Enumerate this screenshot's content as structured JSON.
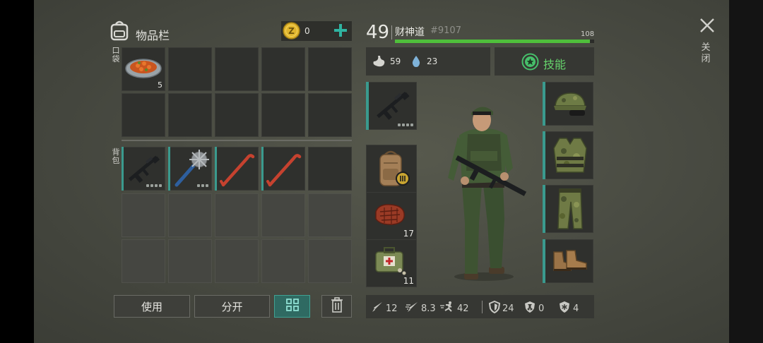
{
  "inventory": {
    "title": "物品栏",
    "coins": "0",
    "pocket_label": "口袋",
    "backpack_label": "背包",
    "pocket_items": [
      {
        "icon": "carrot-stew-icon",
        "count": "5"
      }
    ],
    "backpack_items": [
      {
        "icon": "assault-rifle-icon"
      },
      {
        "icon": "spiked-club-icon"
      },
      {
        "icon": "crowbar-icon"
      },
      {
        "icon": "crowbar-icon"
      }
    ],
    "buttons": {
      "use": "使用",
      "split": "分开"
    }
  },
  "player": {
    "level": "49",
    "name": "财神道",
    "id": "#9107",
    "xp_max": "108",
    "xp_fraction": 0.98,
    "hunger": "59",
    "thirst": "23",
    "skills_label": "技能"
  },
  "equipment": {
    "left": [
      {
        "icon": "assault-rifle-icon",
        "count": ""
      },
      {
        "icon": "backpack-icon",
        "count": ""
      },
      {
        "icon": "steak-icon",
        "count": "17"
      },
      {
        "icon": "first-aid-kit-icon",
        "count": "11"
      }
    ],
    "right": [
      {
        "icon": "camo-cap-icon"
      },
      {
        "icon": "camo-vest-icon"
      },
      {
        "icon": "camo-pants-icon"
      },
      {
        "icon": "boots-icon"
      }
    ]
  },
  "stats": {
    "damage": "12",
    "attack_speed": "8.3",
    "speed": "42",
    "armor": "24",
    "radiation": "0",
    "cold": "4"
  },
  "close": {
    "label": "关闭"
  },
  "colors": {
    "accent": "#3a9a8e",
    "xp_bar": "#4fbf3b",
    "coin": "#e0b52d"
  }
}
